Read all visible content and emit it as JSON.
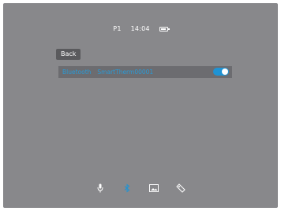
{
  "status": {
    "profile": "P1",
    "time": "14:04",
    "battery_icon": "battery-icon"
  },
  "nav": {
    "back_label": "Back"
  },
  "bluetooth": {
    "label": "Bluetooth",
    "device_name": "SmartTherm00001",
    "enabled": true
  },
  "bottom_bar": {
    "items": [
      {
        "icon": "microphone-icon"
      },
      {
        "icon": "bluetooth-icon"
      },
      {
        "icon": "image-icon"
      },
      {
        "icon": "tag-icon"
      }
    ]
  },
  "colors": {
    "background": "#88888b",
    "accent": "#1f93d4",
    "text": "#ffffff"
  }
}
